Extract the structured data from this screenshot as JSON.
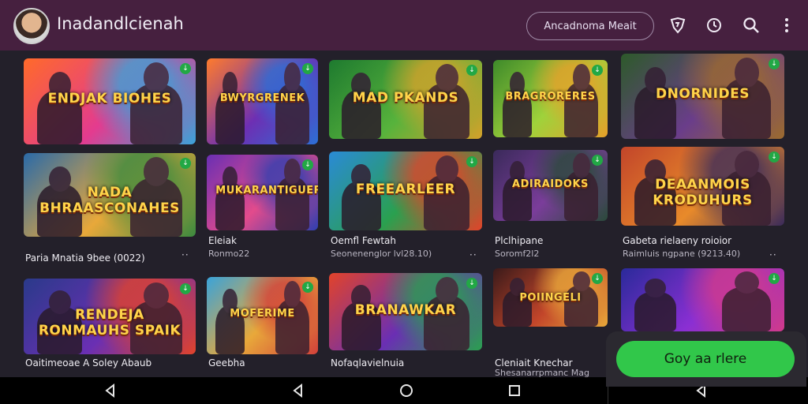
{
  "header": {
    "app_title": "Inadandlcienah",
    "account_label": "Ancadnoma Meait",
    "icons": [
      "shield-icon",
      "sync-icon",
      "search-icon",
      "more-vert-icon"
    ]
  },
  "games": [
    {
      "banner": "ENDJAK BIOHES",
      "title": "",
      "subtitle": "",
      "colors": [
        "#ff6a2a",
        "#e33b8f",
        "#3aa3d9"
      ]
    },
    {
      "banner": "BWYRGRENEK",
      "title": "",
      "subtitle": "",
      "colors": [
        "#ff7b2c",
        "#6d2fb3",
        "#2c6fd6"
      ]
    },
    {
      "banner": "MAD PKANDS",
      "title": "",
      "subtitle": "",
      "colors": [
        "#1e7a2f",
        "#57b33c",
        "#d4a12a"
      ]
    },
    {
      "banner": "BRAGRORERES",
      "title": "",
      "subtitle": "",
      "colors": [
        "#3e8a2a",
        "#9fd23b",
        "#e6a02a"
      ]
    },
    {
      "banner": "DNORNIDES",
      "title": "",
      "subtitle": "",
      "colors": [
        "#2d5a2a",
        "#6a3d8a",
        "#9c6b2e"
      ]
    },
    {
      "banner": "NADA BHRAASCONAHES",
      "title": "Paria Mnatia 9bee (0022)",
      "subtitle": "",
      "colors": [
        "#2a6aa8",
        "#e8a83a",
        "#3b8a3f"
      ]
    },
    {
      "banner": "MUKARANTIGUERS",
      "title": "Eleiak",
      "subtitle": "Ronmo22",
      "colors": [
        "#6a2fb3",
        "#e24b8c",
        "#2f3fb0"
      ]
    },
    {
      "banner": "FREEARLEER",
      "title": "Oemfl Fewtah",
      "subtitle": "Seonenenglor lvl28.10)",
      "colors": [
        "#2a8ad6",
        "#2aa04f",
        "#e2432a"
      ]
    },
    {
      "banner": "ADIRAIDOKS",
      "title": "Plclhipane",
      "subtitle": "Soromf2l2",
      "colors": [
        "#3a2a5a",
        "#7a3d9a",
        "#2a4a3a"
      ]
    },
    {
      "banner": "DEAANMOIS KRODUHURS",
      "title": "Gabeta rielaeny roioior",
      "subtitle": "Raimluis ngpane (9213.40)",
      "colors": [
        "#c2452a",
        "#e88a2a",
        "#3a2a5a"
      ]
    },
    {
      "banner": "RENDEJA RONMAUHS SPAIK",
      "title": "Oaitimeoae A Soley Abaub",
      "subtitle": "",
      "colors": [
        "#2a3a8a",
        "#6a2fb3",
        "#e2432a"
      ]
    },
    {
      "banner": "MOFERIME",
      "title": "Geebha",
      "subtitle": "",
      "colors": [
        "#3aa3d9",
        "#e8a83a",
        "#d2403a"
      ]
    },
    {
      "banner": "BRANAWKAR",
      "title": "Nofaqlavielnuia",
      "subtitle": "",
      "colors": [
        "#e2432a",
        "#6a2fb3",
        "#2aa04f"
      ]
    },
    {
      "banner": "POIINGELI",
      "title": "Cleniait Knechar",
      "subtitle": "Shesanarrpmanc Mag",
      "colors": [
        "#3a1a1a",
        "#c2452a",
        "#e8a83a"
      ]
    },
    {
      "banner": "",
      "title": "",
      "subtitle": "",
      "colors": [
        "#2a2a9a",
        "#8a2fd3",
        "#d23a8a"
      ]
    }
  ],
  "more_label": "··",
  "cta_label": "Goy aa rlere",
  "nav": [
    "back-icon",
    "home-icon",
    "recents-icon",
    "back-icon"
  ],
  "accent": "#31c74a",
  "header_color": "#46203f"
}
